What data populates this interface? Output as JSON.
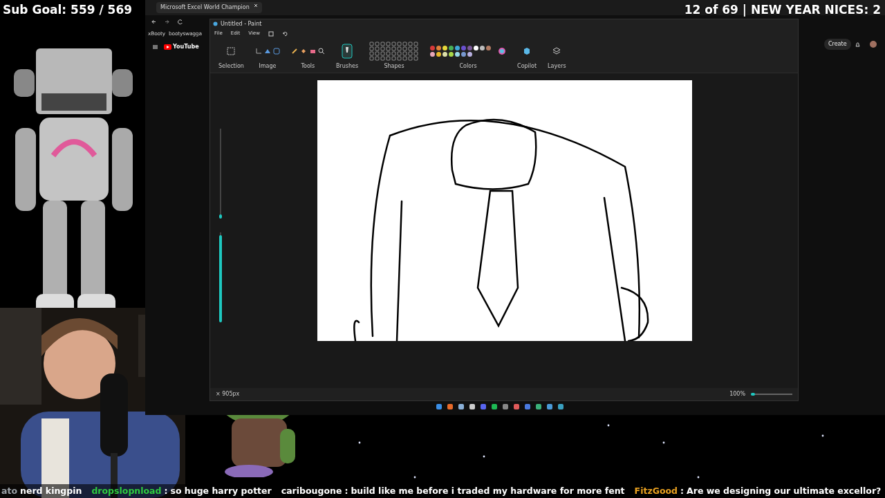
{
  "overlay": {
    "sub_goal": "Sub Goal: 559 / 569",
    "counter": "12 of 69 | NEW YEAR NICES: 2"
  },
  "browser": {
    "tab": "Microsoft Excel World Champion",
    "bookmarks": [
      "xBooty",
      "bootyswagga"
    ],
    "site": "YouTube",
    "create_button": "Create"
  },
  "paint": {
    "title": "Untitled - Paint",
    "menu": [
      "File",
      "Edit",
      "View"
    ],
    "groups": [
      "Selection",
      "Image",
      "Tools",
      "Brushes",
      "Shapes",
      "Colors",
      "Copilot",
      "Layers"
    ],
    "palette": [
      {
        "color": "#d83a3a"
      },
      {
        "color": "#e0803a"
      },
      {
        "color": "#e6d83a"
      },
      {
        "color": "#48b058"
      },
      {
        "color": "#40a8d8"
      },
      {
        "color": "#6a50d0"
      },
      {
        "color": "#7a5898"
      },
      {
        "color": "#ffffff"
      },
      {
        "color": "#bdbdbd"
      },
      {
        "color": "#b07a62"
      },
      {
        "color": "#e8a6b8"
      },
      {
        "color": "#e8b828"
      },
      {
        "color": "#dde0a8"
      },
      {
        "color": "#a8d848"
      },
      {
        "color": "#98d8e8"
      },
      {
        "color": "#7898d0"
      },
      {
        "color": "#b8b0e0"
      }
    ],
    "sliders": [
      {
        "level": 0.05
      },
      {
        "level": 0.97
      }
    ],
    "status": {
      "size": "× 905px",
      "zoom": "100%",
      "zoom_slider": {
        "level": 0.1
      }
    }
  },
  "chat": [
    {
      "user": "ato",
      "text": "nerd kingpin",
      "color": "#9aa0a6"
    },
    {
      "user": "dropslopnload",
      "colon": ":",
      "text": "so huge harry potter",
      "color": "#2ecc40"
    },
    {
      "user": "caribougone",
      "colon": ":",
      "text": "build like me before i traded my hardware for more fent",
      "color": "#ffffff"
    },
    {
      "user": "FitzGood",
      "colon": ":",
      "text": "Are we designing our ultimate excellor?",
      "color": "#e8a020"
    }
  ]
}
